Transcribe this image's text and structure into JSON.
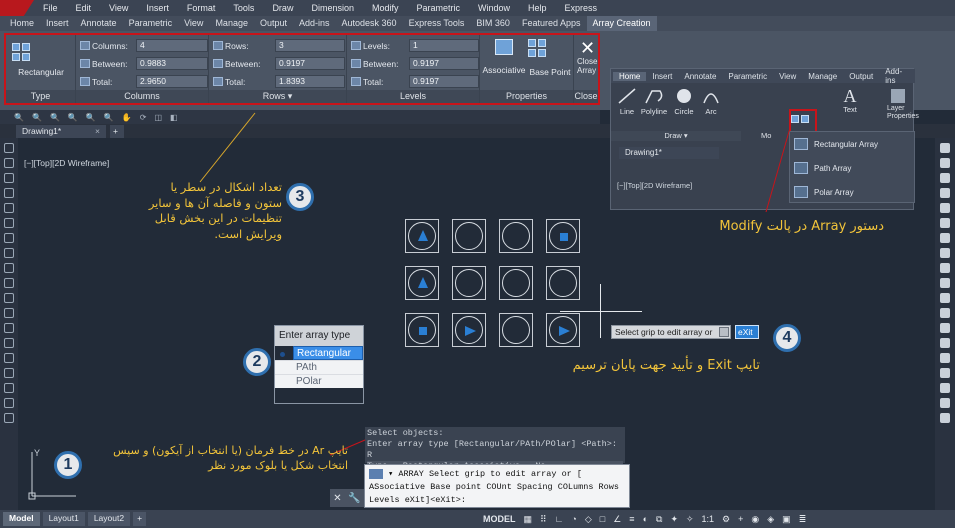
{
  "menu": [
    "File",
    "Edit",
    "View",
    "Insert",
    "Format",
    "Tools",
    "Draw",
    "Dimension",
    "Modify",
    "Parametric",
    "Window",
    "Help",
    "Express"
  ],
  "ribbon_tabs": [
    "Home",
    "Insert",
    "Annotate",
    "Parametric",
    "View",
    "Manage",
    "Output",
    "Add-ins",
    "Autodesk 360",
    "Express Tools",
    "BIM 360",
    "Featured Apps",
    "Array Creation"
  ],
  "type_panel": {
    "button": "Rectangular",
    "title": "Type"
  },
  "columns_panel": {
    "title": "Columns",
    "rows": [
      {
        "label": "Columns:",
        "value": "4"
      },
      {
        "label": "Between:",
        "value": "0.9883"
      },
      {
        "label": "Total:",
        "value": "2.9650"
      }
    ]
  },
  "rows_panel": {
    "title": "Rows ▾",
    "rows": [
      {
        "label": "Rows:",
        "value": "3"
      },
      {
        "label": "Between:",
        "value": "0.9197"
      },
      {
        "label": "Total:",
        "value": "1.8393"
      }
    ]
  },
  "levels_panel": {
    "title": "Levels",
    "rows": [
      {
        "label": "Levels:",
        "value": "1"
      },
      {
        "label": "Between:",
        "value": "0.9197"
      },
      {
        "label": "Total:",
        "value": "0.9197"
      }
    ]
  },
  "properties_panel": {
    "title": "Properties",
    "associative": "Associative",
    "base_point": "Base Point"
  },
  "close_panel": {
    "line1": "Close",
    "line2": "Array",
    "title": "Close"
  },
  "drawing_tab": "Drawing1*",
  "viewport_label": "[−][Top][2D Wireframe]",
  "array_popup": {
    "header": "Enter array type",
    "options": [
      "Rectangular",
      "PAth",
      "POlar"
    ]
  },
  "hint": {
    "text": "Select grip to edit array or",
    "exit": "eXit"
  },
  "cmd_history": [
    "Select objects:",
    "Enter array type [Rectangular/PAth/POlar] <Path>: R",
    "Type = Rectangular  Associative = No"
  ],
  "cmd_line": {
    "line1": "ARRAY Select grip to edit array or [",
    "line2": "ASsociative Base point COUnt Spacing COLumns Rows",
    "line3": "Levels eXit]<eXit>:"
  },
  "status": {
    "tabs": [
      "Model",
      "Layout1",
      "Layout2"
    ],
    "model": "MODEL",
    "scale": "1:1"
  },
  "inset": {
    "tabs": [
      "Home",
      "Insert",
      "Annotate",
      "Parametric",
      "View",
      "Manage",
      "Output",
      "Add-ins"
    ],
    "tools": [
      "Line",
      "Polyline",
      "Circle",
      "Arc",
      "Text",
      "Layer Properties"
    ],
    "draw_title": "Draw ▾",
    "modify_title": "Mo",
    "drawing_tab": "Drawing1*",
    "viewport_label": "[−][Top][2D Wireframe]",
    "array_menu": [
      "Rectangular Array",
      "Path Array",
      "Polar Array"
    ]
  },
  "annotations": {
    "a1": {
      "num": "1",
      "text": "تایپ Ar در خط فرمان (یا انتخاب از آیکون) و سپس انتخاب شکل یا بلوک مورد نظر"
    },
    "a2": {
      "num": "2"
    },
    "a3": {
      "num": "3",
      "text": "تعداد اشکال در سطر یا ستون و فاصله آن ها و سایر تنظیمات در این بخش قابل ویرایش است."
    },
    "a4": {
      "num": "4",
      "text": "تایپ Exit و تأیید جهت پایان ترسیم"
    },
    "a5": {
      "text": "دستور Array در پالت Modify"
    }
  }
}
